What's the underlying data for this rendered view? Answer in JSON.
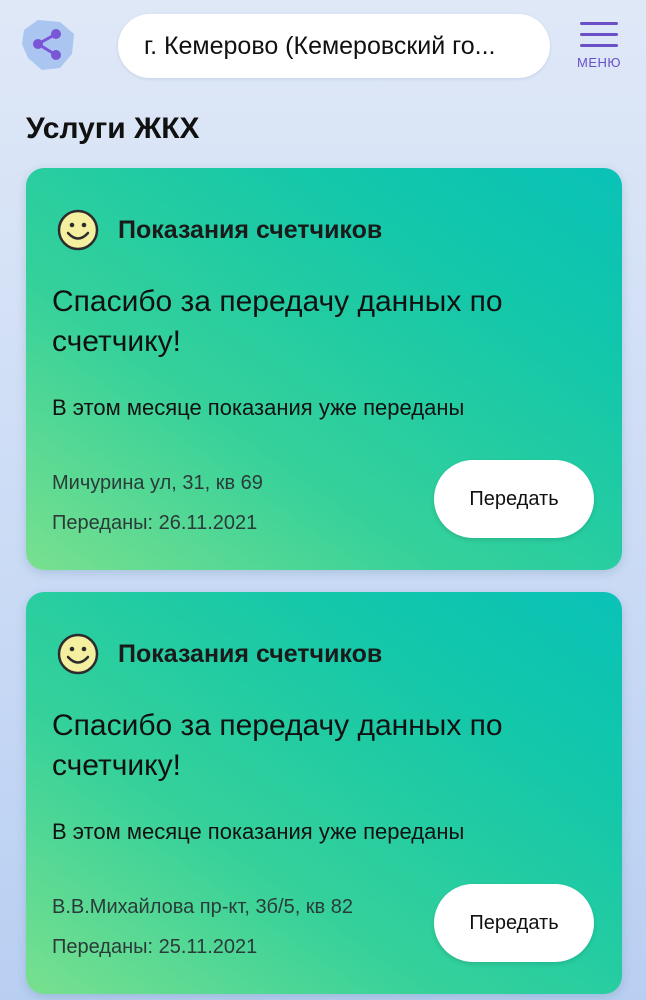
{
  "header": {
    "location": "г. Кемерово (Кемеровский го...",
    "menu_label": "МЕНЮ",
    "region_icon": "region-share-icon",
    "menu_icon": "hamburger-icon"
  },
  "section": {
    "title": "Услуги ЖКХ"
  },
  "cards": [
    {
      "icon": "smiley-icon",
      "title": "Показания счетчиков",
      "headline": "Спасибо за передачу данных по счетчику!",
      "status": "В этом месяце показания уже переданы",
      "address": "Мичурина ул, 31, кв 69",
      "submitted": "Переданы: 26.11.2021",
      "button": "Передать"
    },
    {
      "icon": "smiley-icon",
      "title": "Показания счетчиков",
      "headline": "Спасибо за передачу данных по счетчику!",
      "status": "В этом месяце показания уже переданы",
      "address": "В.В.Михайлова пр-кт, 3б/5, кв 82",
      "submitted": "Переданы: 25.11.2021",
      "button": "Передать"
    }
  ],
  "colors": {
    "accent": "#6a4fc7",
    "card_start": "#79e08e",
    "card_end": "#0ac2b7",
    "smiley": "#f4f0a0"
  }
}
